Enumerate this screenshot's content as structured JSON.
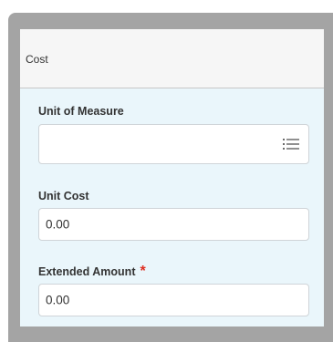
{
  "section": {
    "title": "Cost"
  },
  "fields": {
    "unit_of_measure": {
      "label": "Unit of Measure",
      "value": "",
      "icon": "list-icon"
    },
    "unit_cost": {
      "label": "Unit Cost",
      "value": "0.00"
    },
    "extended_amount": {
      "label": "Extended Amount",
      "required_marker": "*",
      "value": "0.00"
    }
  },
  "colors": {
    "frame": "#a4a4a4",
    "panel_background": "#eaf6fb",
    "header_background": "#f6f6f6",
    "required": "#de2e21",
    "input_border": "#cfd4d8"
  }
}
